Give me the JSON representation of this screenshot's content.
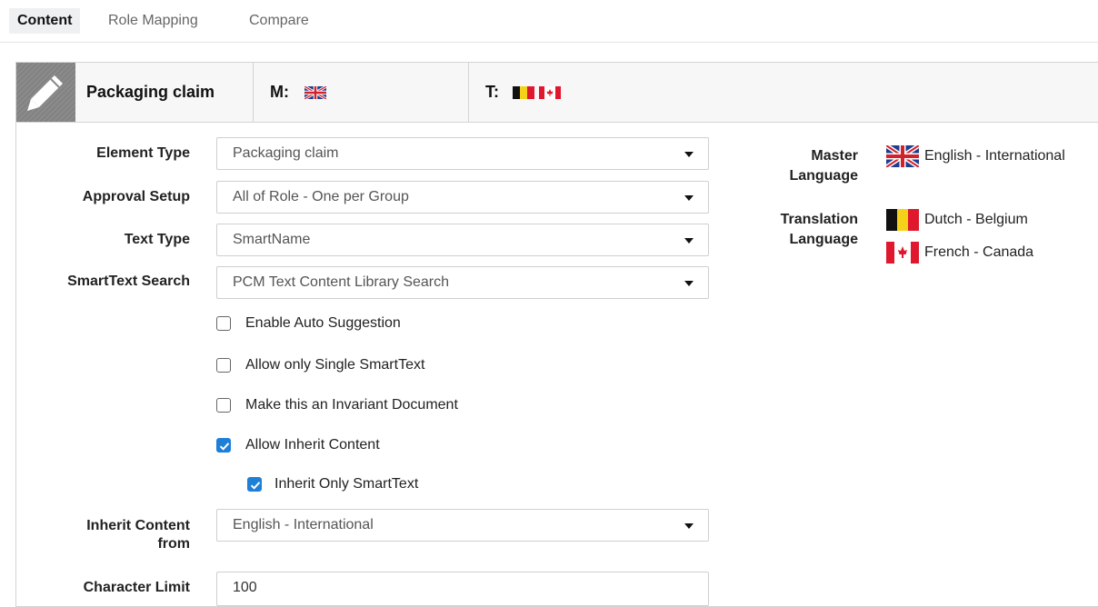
{
  "tabs": [
    {
      "label": "Content",
      "active": true
    },
    {
      "label": "Role Mapping",
      "active": false
    },
    {
      "label": "Compare",
      "active": false
    }
  ],
  "header": {
    "title": "Packaging claim",
    "master_prefix": "M:",
    "translation_prefix": "T:",
    "edit_icon": "pencil-icon",
    "tile_color": "#8a8a8a"
  },
  "form": {
    "element_type": {
      "label": "Element Type",
      "value": "Packaging claim"
    },
    "approval_setup": {
      "label": "Approval Setup",
      "value": "All of Role - One per Group"
    },
    "text_type": {
      "label": "Text Type",
      "value": "SmartName"
    },
    "smarttext_search": {
      "label": "SmartText Search",
      "value": "PCM Text Content Library Search"
    },
    "checkboxes": [
      {
        "label": "Enable Auto Suggestion",
        "checked": false
      },
      {
        "label": "Allow only Single SmartText",
        "checked": false
      },
      {
        "label": "Make this an Invariant Document",
        "checked": false
      },
      {
        "label": "Allow Inherit Content",
        "checked": true
      },
      {
        "label": "Inherit Only SmartText",
        "checked": true
      }
    ],
    "inherit_from": {
      "label_line1": "Inherit Content",
      "label_line2": "from",
      "value": "English - International"
    },
    "character_limit": {
      "label": "Character Limit",
      "value": "100"
    }
  },
  "languages": {
    "master_label_line1": "Master",
    "master_label_line2": "Language",
    "master": {
      "name": "English - International",
      "flag": "uk-flag"
    },
    "translation_label_line1": "Translation",
    "translation_label_line2": "Language",
    "translations": [
      {
        "name": "Dutch - Belgium",
        "flag": "belgium-flag"
      },
      {
        "name": "French - Canada",
        "flag": "canada-flag"
      }
    ]
  },
  "colors": {
    "checkbox_accent": "#1e7fd6",
    "tab_active_bg": "#eef0f2"
  }
}
